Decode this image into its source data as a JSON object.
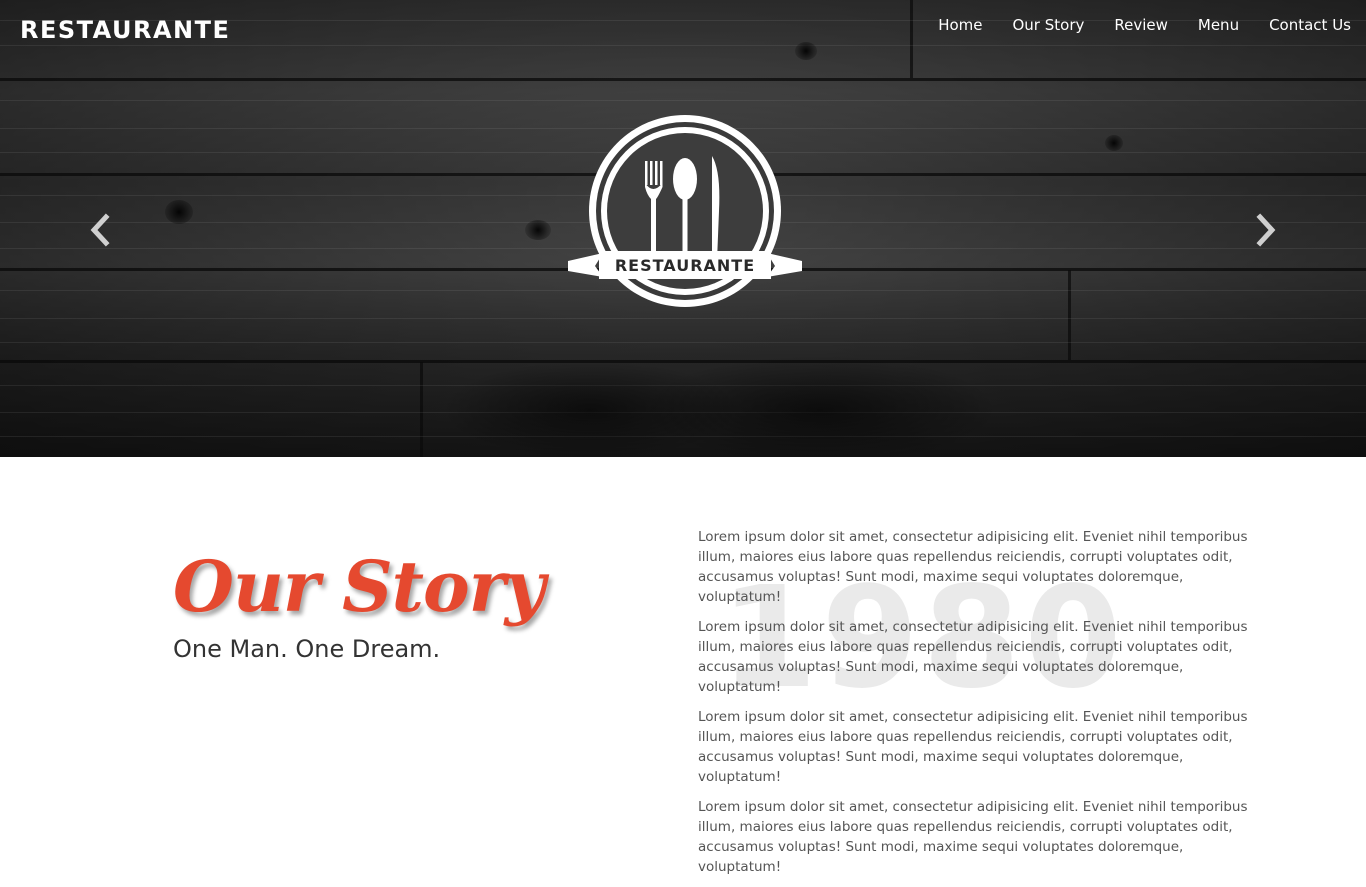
{
  "brand": {
    "name": "RESTAURANTE"
  },
  "nav": {
    "items": [
      "Home",
      "Our Story",
      "Review",
      "Menu",
      "Contact Us"
    ]
  },
  "hero": {
    "logo_text": "RESTAURANTE",
    "prev_icon": "chevron-left-icon",
    "next_icon": "chevron-right-icon"
  },
  "story": {
    "title": "Our Story",
    "subtitle": "One Man. One Dream.",
    "year_watermark": "1980",
    "paragraphs": [
      "Lorem ipsum dolor sit amet, consectetur adipisicing elit. Eveniet nihil temporibus illum, maiores eius labore quas repellendus reiciendis, corrupti voluptates odit, accusamus voluptas! Sunt modi, maxime sequi voluptates doloremque, voluptatum!",
      "Lorem ipsum dolor sit amet, consectetur adipisicing elit. Eveniet nihil temporibus illum, maiores eius labore quas repellendus reiciendis, corrupti voluptates odit, accusamus voluptas! Sunt modi, maxime sequi voluptates doloremque, voluptatum!",
      "Lorem ipsum dolor sit amet, consectetur adipisicing elit. Eveniet nihil temporibus illum, maiores eius labore quas repellendus reiciendis, corrupti voluptates odit, accusamus voluptas! Sunt modi, maxime sequi voluptates doloremque, voluptatum!",
      "Lorem ipsum dolor sit amet, consectetur adipisicing elit. Eveniet nihil temporibus illum, maiores eius labore quas repellendus reiciendis, corrupti voluptates odit, accusamus voluptas! Sunt modi, maxime sequi voluptates doloremque, voluptatum!"
    ]
  },
  "colors": {
    "accent": "#e5492f",
    "text": "#555555",
    "hero_text": "#ffffff"
  }
}
